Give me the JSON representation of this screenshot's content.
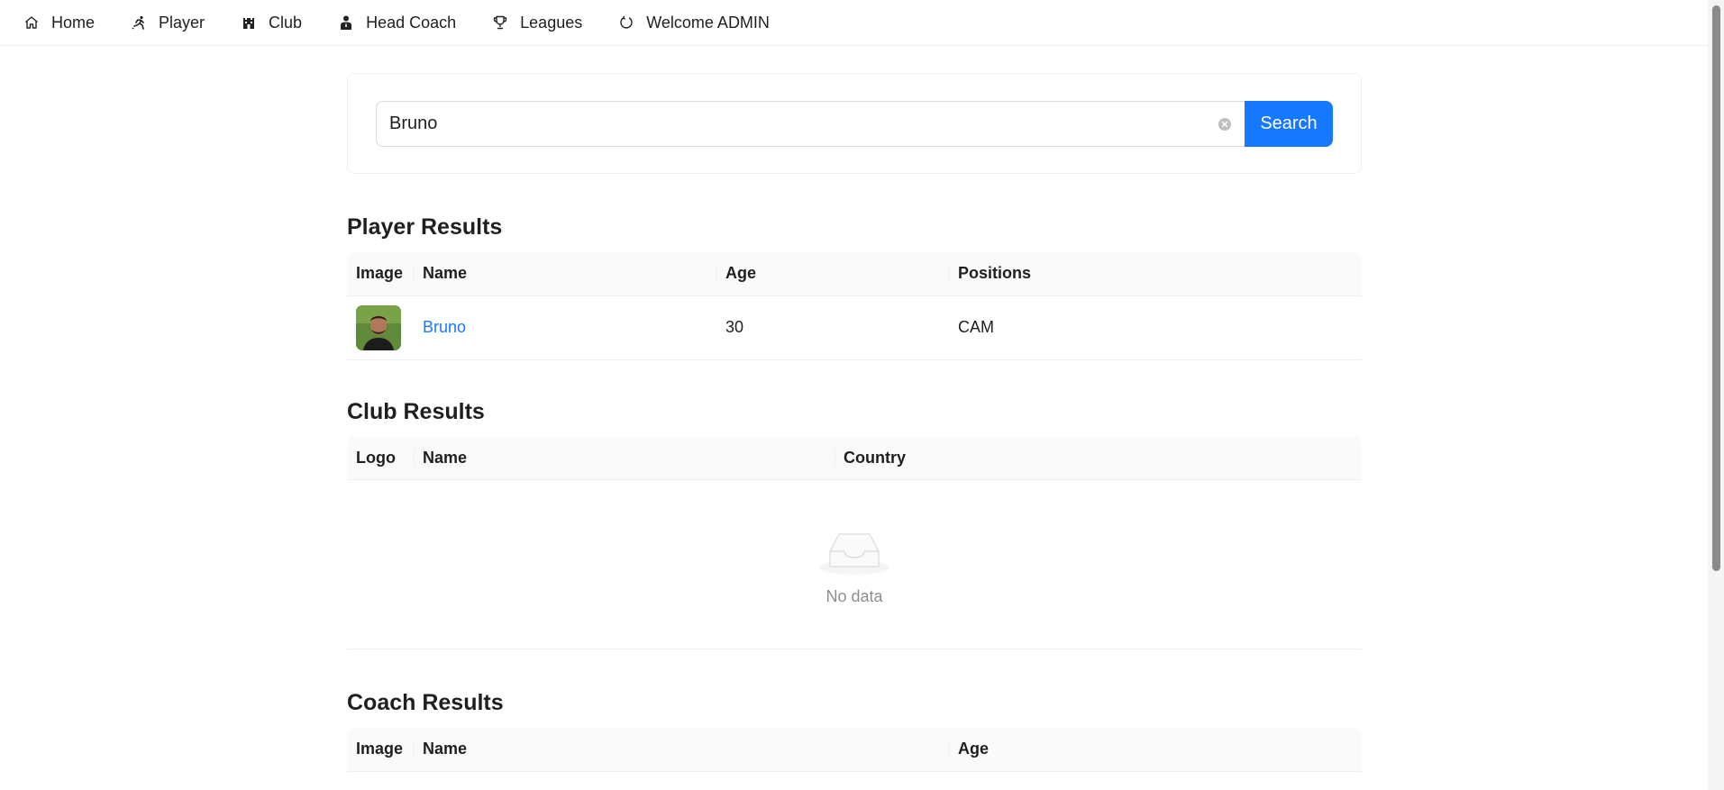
{
  "nav": {
    "items": [
      {
        "label": "Home",
        "icon": "home-icon"
      },
      {
        "label": "Player",
        "icon": "runner-icon"
      },
      {
        "label": "Club",
        "icon": "castle-icon"
      },
      {
        "label": "Head Coach",
        "icon": "coach-icon"
      },
      {
        "label": "Leagues",
        "icon": "trophy-icon"
      },
      {
        "label": "Welcome ADMIN",
        "icon": "logout-icon"
      }
    ]
  },
  "search": {
    "value": "Bruno",
    "button_label": "Search"
  },
  "player_results": {
    "title": "Player Results",
    "columns": [
      "Image",
      "Name",
      "Age",
      "Positions"
    ],
    "rows": [
      {
        "name": "Bruno",
        "age": "30",
        "positions": "CAM"
      }
    ]
  },
  "club_results": {
    "title": "Club Results",
    "columns": [
      "Logo",
      "Name",
      "Country"
    ],
    "empty_text": "No data"
  },
  "coach_results": {
    "title": "Coach Results",
    "columns": [
      "Image",
      "Name",
      "Age"
    ]
  },
  "colors": {
    "primary": "#1677ff",
    "border": "#f0f0f0",
    "header_bg": "#fafafa"
  }
}
